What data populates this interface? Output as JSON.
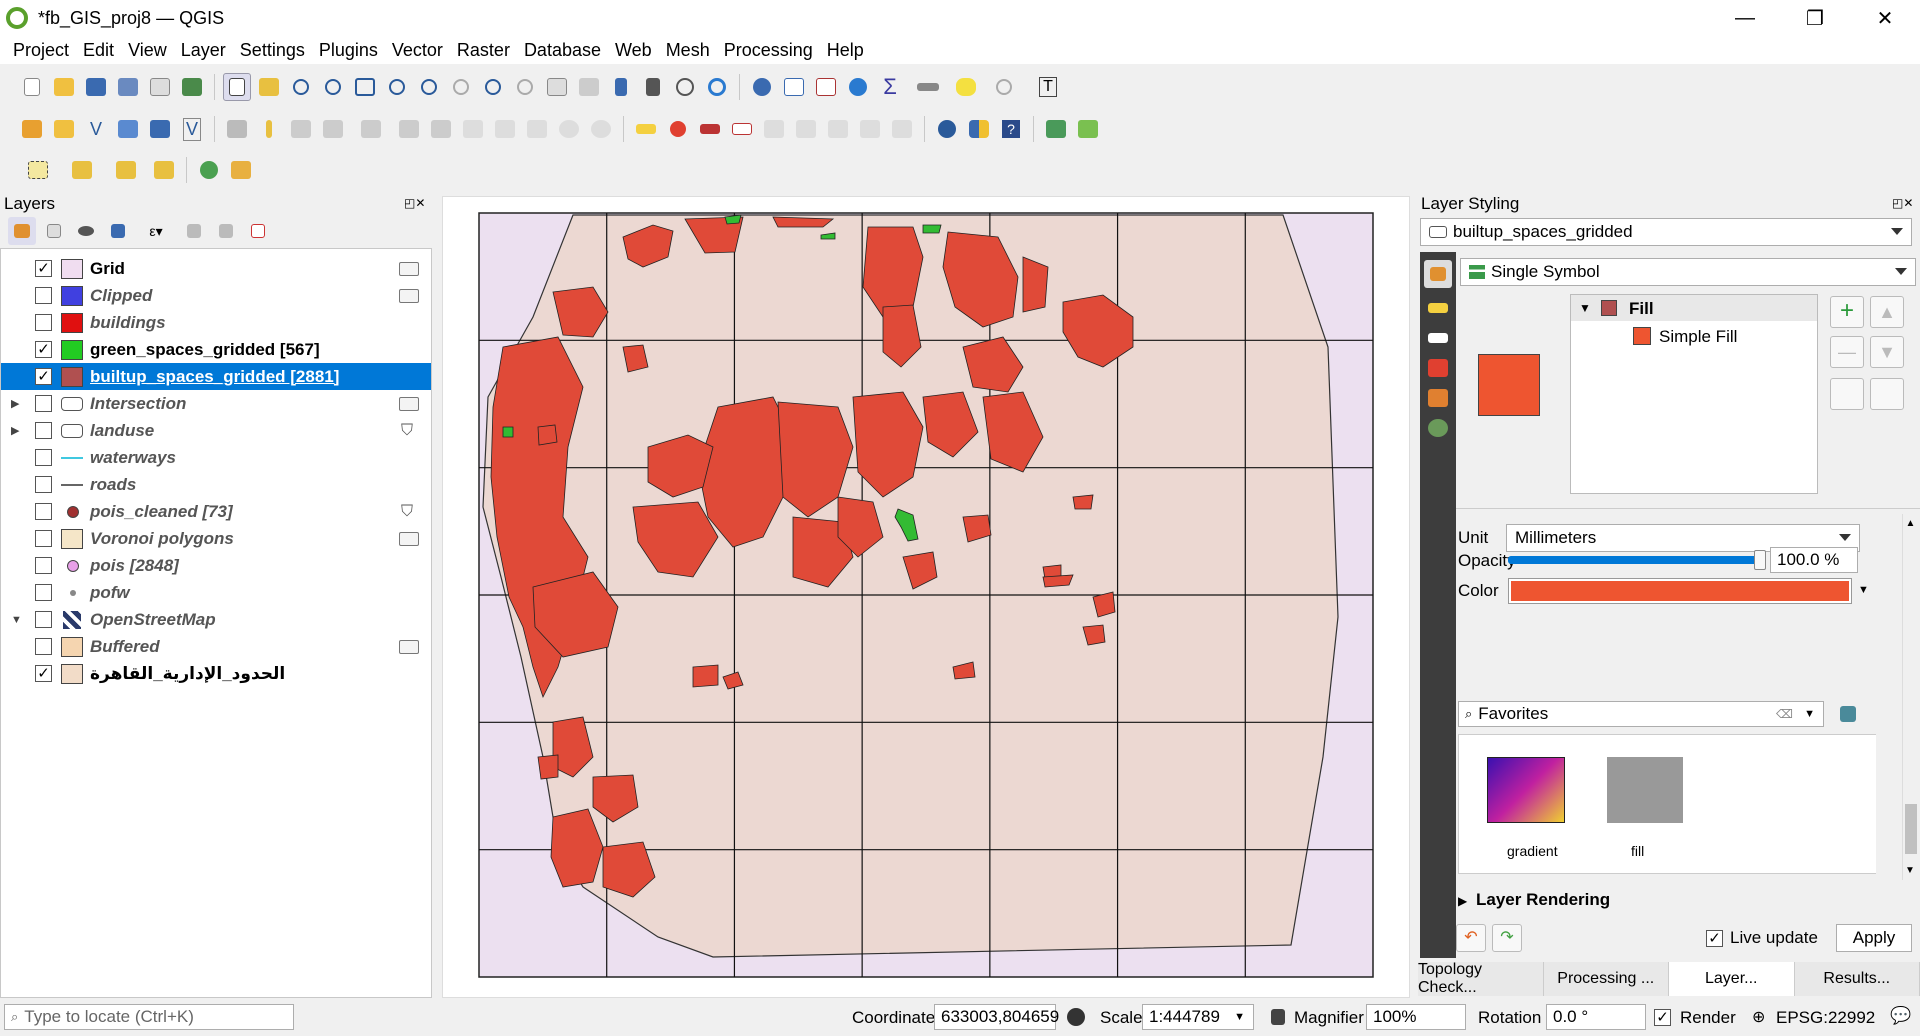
{
  "window": {
    "title": "*fb_GIS_proj8 — QGIS",
    "minimize": "—",
    "restore": "❐",
    "close": "✕"
  },
  "menu": [
    "Project",
    "Edit",
    "View",
    "Layer",
    "Settings",
    "Plugins",
    "Vector",
    "Raster",
    "Database",
    "Web",
    "Mesh",
    "Processing",
    "Help"
  ],
  "layers_panel": {
    "title": "Layers",
    "items": [
      {
        "name": "Grid",
        "checked": true,
        "swatch": "#f0ddf0",
        "bold": true,
        "indicator": "rect"
      },
      {
        "name": "Clipped",
        "checked": false,
        "swatch": "#4040e0",
        "indicator": "rect"
      },
      {
        "name": "buildings",
        "checked": false,
        "swatch": "#e01010",
        "indicator": ""
      },
      {
        "name": "green_spaces_gridded [567]",
        "checked": true,
        "swatch": "#22cc22",
        "bold": true,
        "indicator": ""
      },
      {
        "name": "builtup_spaces_gridded [2881]",
        "checked": true,
        "swatch": "#b05050",
        "bold": true,
        "selected": true,
        "indicator": ""
      },
      {
        "name": "Intersection",
        "checked": false,
        "swatch": "group",
        "indicator": "rect",
        "expand": "▶"
      },
      {
        "name": "landuse",
        "checked": false,
        "swatch": "group",
        "indicator": "filter",
        "expand": "▶"
      },
      {
        "name": "waterways",
        "checked": false,
        "swatch": "line-cyan",
        "indicator": ""
      },
      {
        "name": "roads",
        "checked": false,
        "swatch": "line-gray",
        "indicator": ""
      },
      {
        "name": "pois_cleaned [73]",
        "checked": false,
        "swatch": "dot-red",
        "indicator": "filter"
      },
      {
        "name": "Voronoi polygons",
        "checked": false,
        "swatch": "#f5e6c8",
        "indicator": "rect"
      },
      {
        "name": "pois [2848]",
        "checked": false,
        "swatch": "dot-pink",
        "indicator": ""
      },
      {
        "name": "pofw",
        "checked": false,
        "swatch": "dot-small",
        "indicator": ""
      },
      {
        "name": "OpenStreetMap",
        "checked": false,
        "swatch": "osm",
        "indicator": "",
        "expand": "▼"
      },
      {
        "name": "Buffered",
        "checked": false,
        "swatch": "#f5d5b0",
        "indicator": "rect"
      },
      {
        "name": "الحدود_الإدارية_القاهرة",
        "checked": true,
        "swatch": "#f2dcc8",
        "bold": true,
        "indicator": ""
      }
    ]
  },
  "styling": {
    "title": "Layer Styling",
    "layer": "builtup_spaces_gridded",
    "renderer": "Single Symbol",
    "tree_fill": "Fill",
    "tree_simple": "Simple Fill",
    "unit_label": "Unit",
    "unit": "Millimeters",
    "opacity_label": "Opacity",
    "opacity": "100.0 %",
    "opacity_fraction": 1.0,
    "color_label": "Color",
    "color": "#ee5530",
    "favorites": "Favorites",
    "layer_rendering": "Layer Rendering",
    "live_update": "Live update",
    "apply": "Apply",
    "fav_items": [
      "gradient",
      "fill"
    ]
  },
  "bottom_tabs": [
    "Topology Check...",
    "Processing ...",
    "Layer...",
    "Results..."
  ],
  "status": {
    "locate_placeholder": "Type to locate (Ctrl+K)",
    "coord_label": "Coordinate",
    "coord": "633003,804659",
    "scale_label": "Scale",
    "scale": "1:444789",
    "magnifier_label": "Magnifier",
    "magnifier": "100%",
    "rotation_label": "Rotation",
    "rotation": "0.0 °",
    "render": "Render",
    "crs": "EPSG:22992"
  },
  "colors": {
    "builtup": "#e04a38",
    "green": "#33bb33",
    "admin": "#ecd8d2",
    "grid_bg": "#ece0f0",
    "selection": "#0078d7"
  }
}
